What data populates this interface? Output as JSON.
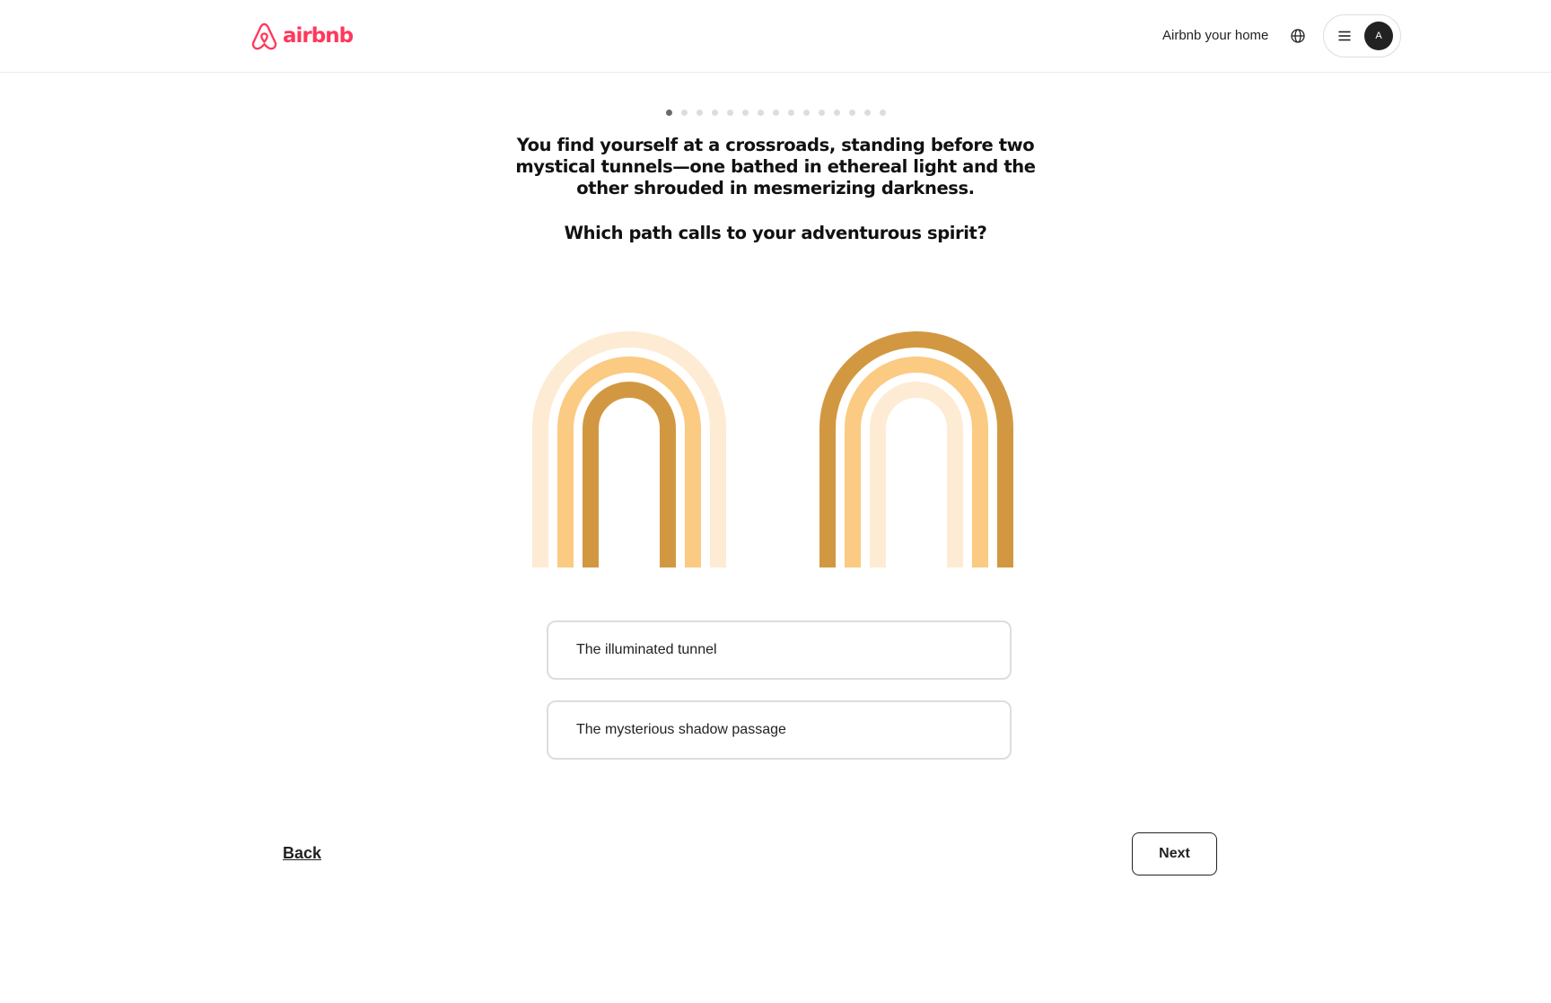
{
  "header": {
    "logo_text": "airbnb",
    "host_link": "Airbnb your home",
    "avatar_initial": "A",
    "brand_color": "#ff385c"
  },
  "progress": {
    "total_steps": 15,
    "current_step": 1
  },
  "quiz": {
    "question": "You find yourself at a crossroads, standing before two mystical tunnels—one bathed in ethereal light and the other shrouded in mesmerizing darkness.",
    "prompt": "Which path calls to your adventurous spirit?",
    "options": [
      {
        "label": "The illuminated tunnel"
      },
      {
        "label": "The mysterious shadow passage"
      }
    ],
    "arch_colors": {
      "light": "#feebd4",
      "mid": "#fbca83",
      "dark": "#d29841"
    }
  },
  "footer": {
    "back_label": "Back",
    "next_label": "Next"
  },
  "icons": [
    "airbnb-logo-icon",
    "globe-icon",
    "menu-icon"
  ]
}
